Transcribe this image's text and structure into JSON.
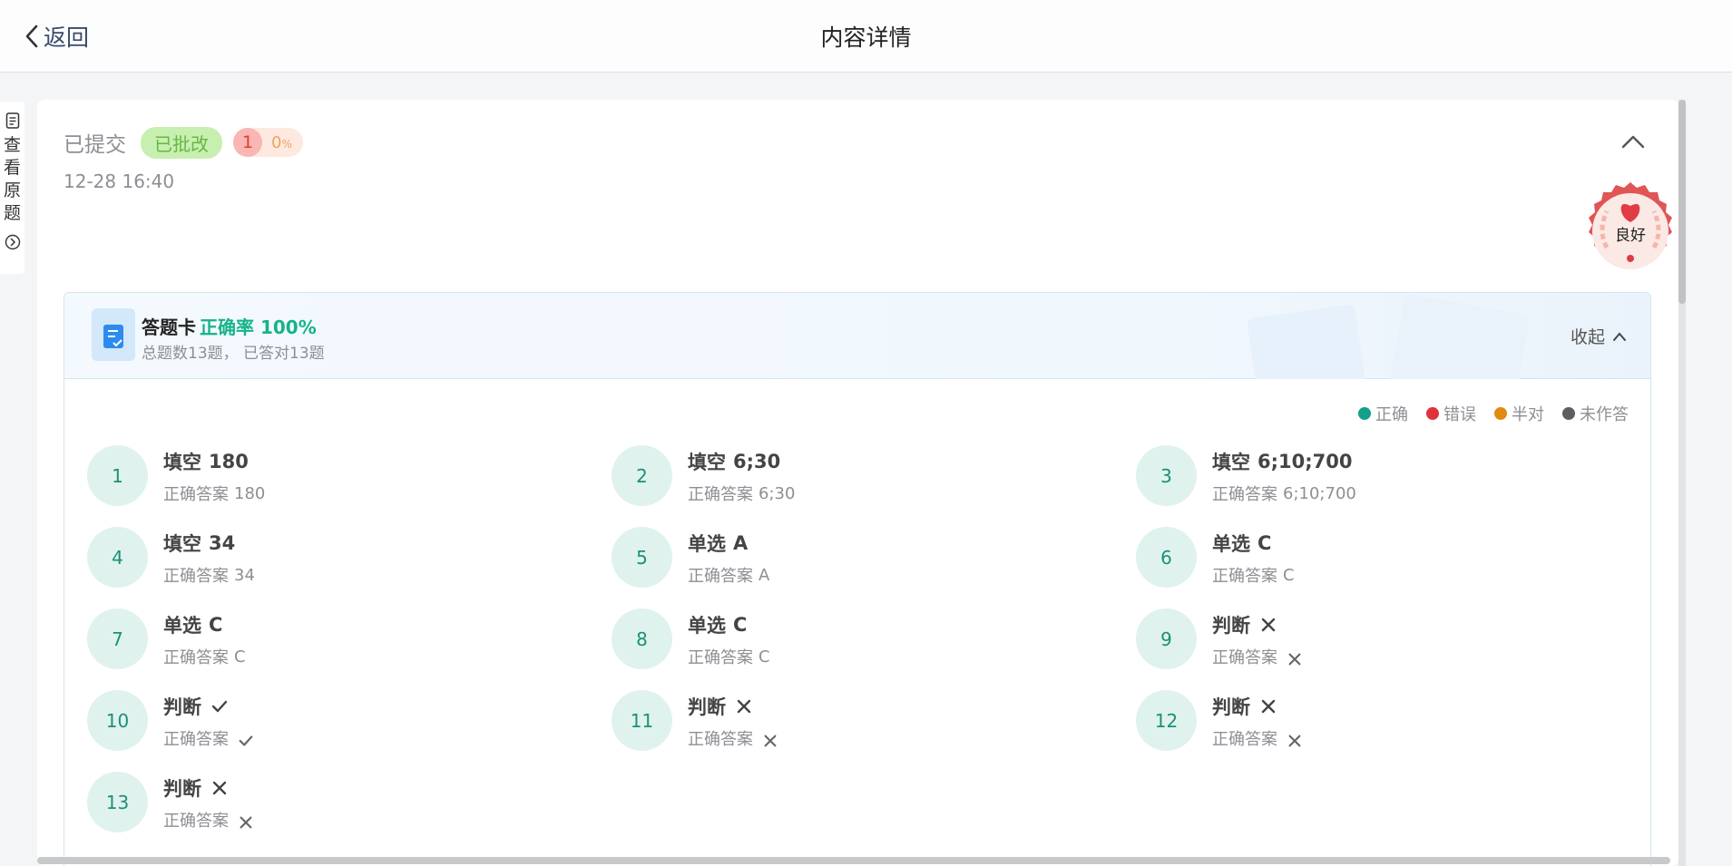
{
  "header": {
    "back_label": "返回",
    "title": "内容详情"
  },
  "side_tab": {
    "label": "查看原题"
  },
  "status": {
    "submitted_label": "已提交",
    "graded_label": "已批改",
    "score": "1",
    "percent": "0",
    "percent_unit": "%",
    "datetime": "12-28 16:40"
  },
  "stamp": {
    "label": "良好"
  },
  "answer_card": {
    "title": "答题卡",
    "rate_label": "正确率 100%",
    "summary": "总题数13题， 已答对13题",
    "collapse_label": "收起"
  },
  "legend": [
    {
      "label": "正确",
      "color": "#13a08b"
    },
    {
      "label": "错误",
      "color": "#e0323b"
    },
    {
      "label": "半对",
      "color": "#e08a10"
    },
    {
      "label": "未作答",
      "color": "#5b5e63"
    }
  ],
  "questions": [
    {
      "num": "1",
      "type": "填空",
      "answer": "180",
      "correct_label": "正确答案",
      "correct": "180"
    },
    {
      "num": "2",
      "type": "填空",
      "answer": "6;30",
      "correct_label": "正确答案",
      "correct": "6;30"
    },
    {
      "num": "3",
      "type": "填空",
      "answer": "6;10;700",
      "correct_label": "正确答案",
      "correct": "6;10;700"
    },
    {
      "num": "4",
      "type": "填空",
      "answer": "34",
      "correct_label": "正确答案",
      "correct": "34"
    },
    {
      "num": "5",
      "type": "单选",
      "answer": "A",
      "correct_label": "正确答案",
      "correct": "A"
    },
    {
      "num": "6",
      "type": "单选",
      "answer": "C",
      "correct_label": "正确答案",
      "correct": "C"
    },
    {
      "num": "7",
      "type": "单选",
      "answer": "C",
      "correct_label": "正确答案",
      "correct": "C"
    },
    {
      "num": "8",
      "type": "单选",
      "answer": "C",
      "correct_label": "正确答案",
      "correct": "C"
    },
    {
      "num": "9",
      "type": "判断",
      "answer_icon": "cross-icon",
      "correct_label": "正确答案",
      "correct_icon": "cross-icon"
    },
    {
      "num": "10",
      "type": "判断",
      "answer_icon": "check-icon",
      "correct_label": "正确答案",
      "correct_icon": "check-icon"
    },
    {
      "num": "11",
      "type": "判断",
      "answer_icon": "cross-icon",
      "correct_label": "正确答案",
      "correct_icon": "cross-icon"
    },
    {
      "num": "12",
      "type": "判断",
      "answer_icon": "cross-icon",
      "correct_label": "正确答案",
      "correct_icon": "cross-icon"
    },
    {
      "num": "13",
      "type": "判断",
      "answer_icon": "cross-icon",
      "correct_label": "正确答案",
      "correct_icon": "cross-icon"
    }
  ]
}
